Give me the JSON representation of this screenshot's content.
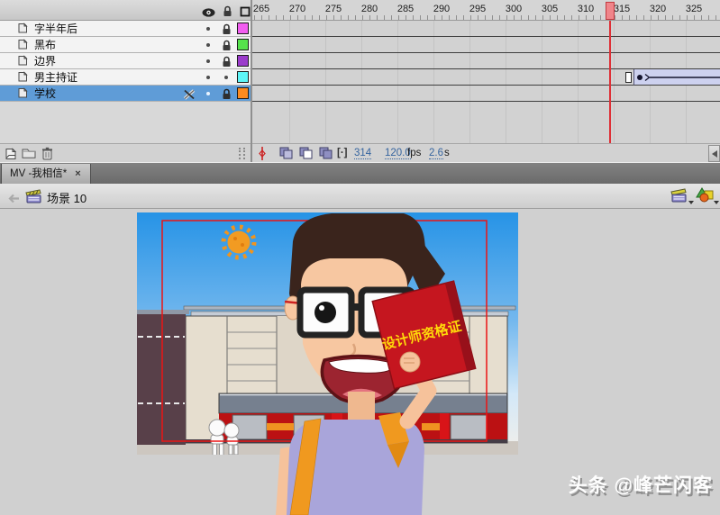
{
  "timeline": {
    "ruler_frames": [
      "265",
      "270",
      "275",
      "280",
      "285",
      "290",
      "295",
      "300",
      "305",
      "310",
      "315",
      "320",
      "325"
    ],
    "layers": [
      {
        "name": "字半年后",
        "outline_color": "#f25ef0",
        "visible": true,
        "locked": true,
        "selected": false
      },
      {
        "name": "黑布",
        "outline_color": "#55e24b",
        "visible": true,
        "locked": true,
        "selected": false
      },
      {
        "name": "边界",
        "outline_color": "#9b3ccb",
        "visible": true,
        "locked": true,
        "selected": false
      },
      {
        "name": "男主持证",
        "outline_color": "#5df5f7",
        "visible": true,
        "locked": false,
        "selected": false
      },
      {
        "name": "学校",
        "outline_color": "#fb8b20",
        "visible": true,
        "locked": true,
        "selected": true
      }
    ],
    "status": {
      "current_frame": "314",
      "frame_rate": "120.0",
      "frame_rate_unit": "fps",
      "elapsed_time": "2.6",
      "elapsed_time_unit": "s",
      "modify_markers_glyph": "[·]"
    },
    "playhead_frame": "314"
  },
  "document_tab": {
    "title": "MV -我相信*",
    "close_label": "×"
  },
  "edit_bar": {
    "scene_label": "场景 10"
  },
  "stage": {
    "certificate_text": "设计师资格证",
    "watermark": "头条 @峰芒闪客"
  },
  "colors": {
    "selection_blue": "#5f9cd7",
    "playhead_red": "#de2f36",
    "tween_span": "#cdd1ef",
    "stage_pasteboard": "#d0d0d0"
  }
}
